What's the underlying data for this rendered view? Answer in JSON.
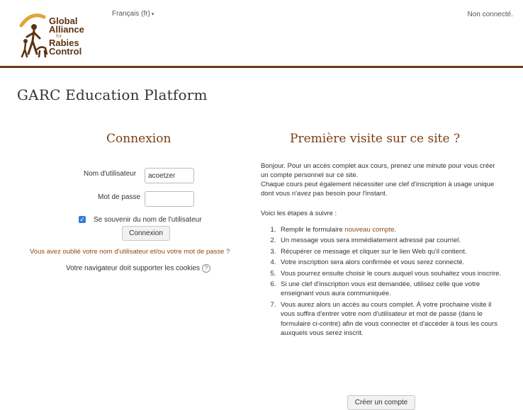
{
  "header": {
    "logo": {
      "line1": "Global",
      "line2": "Alliance",
      "line3": "for",
      "line4": "Rabies",
      "line5": "Control"
    },
    "language": "Français (fr)",
    "login_status": "Non connecté."
  },
  "site_title": "GARC Education Platform",
  "login": {
    "heading": "Connexion",
    "username_label": "Nom d'utilisateur",
    "username_value": "acoetzer",
    "password_label": "Mot de passe",
    "password_value": "",
    "remember_checked": true,
    "remember_label": "Se souvenir du nom de l'utilisateur",
    "submit_label": "Connexion",
    "forgot_link": "Vous avez oublié votre nom d'utilisateur et/ou votre mot de passe ?",
    "cookies_note": "Votre navigateur doit supporter les cookies"
  },
  "first_visit": {
    "heading": "Première visite sur ce site ?",
    "intro_1": "Bonjour. Pour un accès complet aux cours, prenez une minute pour vous créer un compte personnel sur ce site.",
    "intro_2": "Chaque cours peut également nécessiter une clef d'inscription à usage unique dont vous n'avez pas besoin pour l'instant.",
    "steps_label": "Voici les étapes à suivre :",
    "step1_prefix": "Remplir le formulaire ",
    "step1_link": "nouveau compte",
    "step1_suffix": ".",
    "steps": [
      "Un message vous sera immédiatement adressé par courriel.",
      "Récupérer ce message et cliquer sur le lien Web qu'il contient.",
      "Votre inscription sera alors confirmée et vous serez connecté.",
      "Vous pourrez ensuite choisir le cours auquel vous souhaitez vous inscrire.",
      "Si une clef d'inscription vous est demandée, utilisez celle que votre enseignant vous aura communiquée.",
      "Vous aurez alors un accès au cours complet. À votre prochaine visite il vous suffira d'entrer votre nom d'utilisateur et mot de passe (dans le formulaire ci-contre) afin de vous connecter et d'accéder à tous les cours auxquels vous serez inscrit."
    ],
    "create_account_label": "Créer un compte"
  },
  "colors": {
    "brand": "#6e3a13",
    "accent": "#8a4a1a",
    "checkbox": "#3a7bd5"
  }
}
